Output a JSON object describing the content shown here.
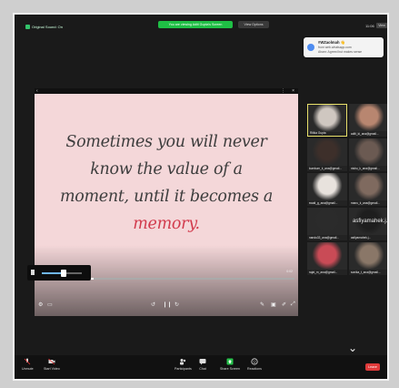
{
  "topbar": {
    "meeting_label": "Original Sound: On",
    "share_banner": "You are viewing Aditi Gupta's Screen",
    "view_options": "View Options",
    "clock": "11:06",
    "view_label": "View"
  },
  "notification": {
    "title": "#WZaolmah 👋",
    "line1": "from web.whatsapp.com",
    "line2": "Aham: Agreed but makes sense"
  },
  "slide": {
    "quote_line1": "Sometimes you will never",
    "quote_line2": "know the value of a",
    "quote_line3": "moment, until it becomes a",
    "quote_highlight": "memory.",
    "time_display": "0:02",
    "progress": 0.02,
    "volume": 0.55,
    "highlight_color": "#d23a4c"
  },
  "gallery": {
    "tiles": [
      {
        "name": "Ritika Gupta",
        "active": true
      },
      {
        "name": "aditi_ki_ana@gmail..."
      },
      {
        "name": "kumkum_k_ana@gmail..."
      },
      {
        "name": "nishu_k_ana@gmail..."
      },
      {
        "name": "swati_g_ana@gmail..."
      },
      {
        "name": "manu_k_ana@gmail..."
      },
      {
        "name": "nandu33_ana@gmail..."
      },
      {
        "name": "asfiyamahek.j...",
        "label_big": "asfiyamahek.j..."
      },
      {
        "name": "rajat_m_ana@gmail..."
      },
      {
        "name": "sonika_t_ana@gmail..."
      }
    ]
  },
  "toolbar": {
    "unmute": "Unmute",
    "start_video": "Start Video",
    "participants": "Participants",
    "participants_count": "16",
    "chat": "Chat",
    "share_screen": "Share Screen",
    "reactions": "Reactions",
    "leave": "Leave"
  }
}
